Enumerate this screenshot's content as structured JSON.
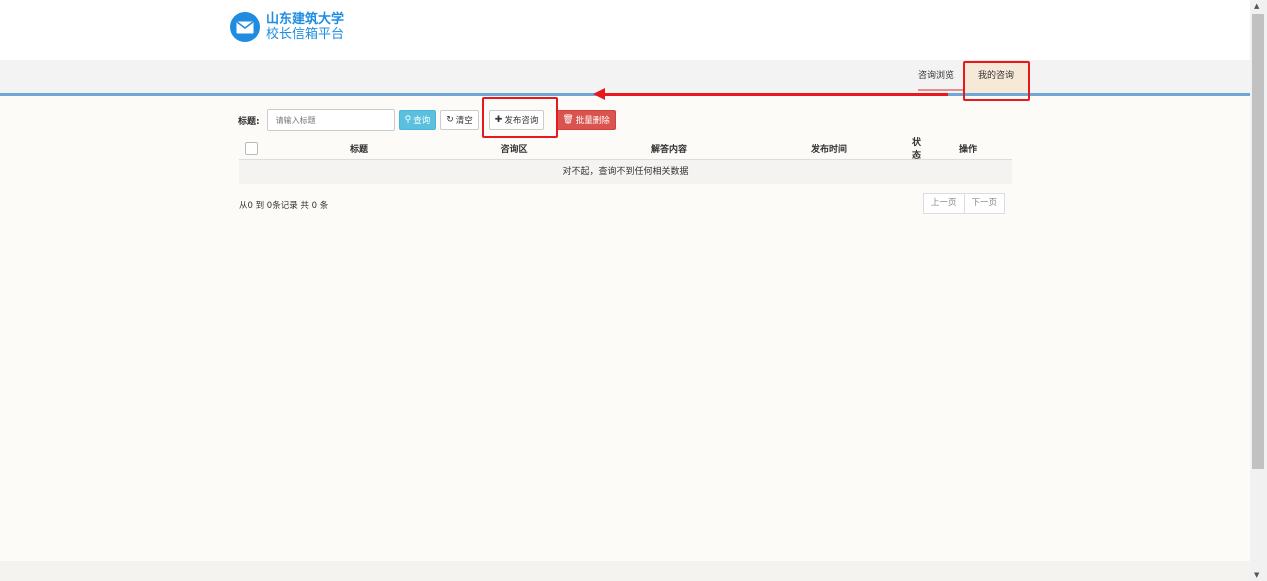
{
  "header": {
    "logo_line1": "山东建筑大学",
    "logo_line2": "校长信箱平台",
    "logo_icon": "envelope-icon"
  },
  "nav": {
    "browse": "咨询浏览",
    "my": "我的咨询"
  },
  "search": {
    "label": "标题:",
    "placeholder": "请输入标题",
    "query_btn": "查询",
    "clear_btn": "清空",
    "add_btn": "发布咨询",
    "delete_btn": "批量删除"
  },
  "table": {
    "columns": [
      "标题",
      "咨询区",
      "解答内容",
      "发布时间",
      "状态",
      "操作"
    ],
    "empty_message": "对不起，查询不到任何相关数据"
  },
  "footer": {
    "info": "从0 到 0条记录 共 0 条",
    "prev": "上一页",
    "next": "下一页"
  },
  "colors": {
    "brand": "#1f8ce0",
    "annotation": "#e8191e",
    "query": "#5bc0de",
    "delete": "#d9534f"
  }
}
